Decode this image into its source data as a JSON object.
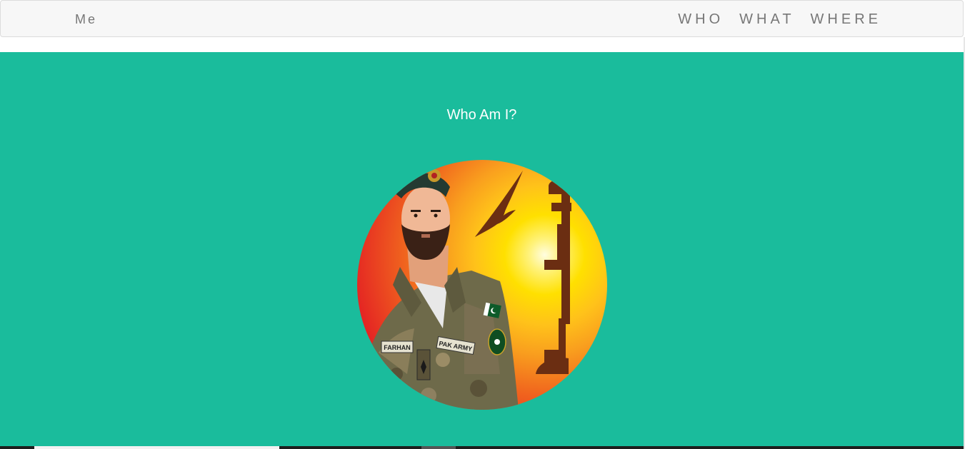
{
  "navbar": {
    "brand": "Me",
    "links": [
      "WHO",
      "WHAT",
      "WHERE"
    ]
  },
  "hero": {
    "title": "Who Am I?",
    "background_color": "#1abc9c",
    "avatar": {
      "name_tag": "FARHAN",
      "unit_tag": "PAK ARMY"
    }
  }
}
